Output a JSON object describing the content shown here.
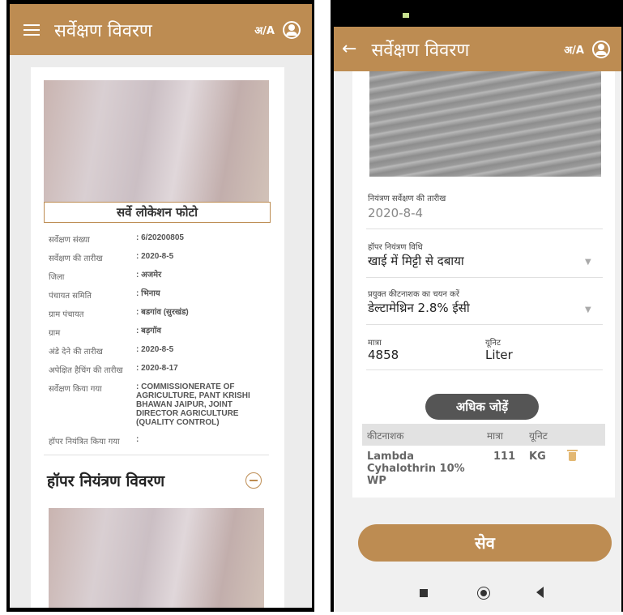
{
  "left": {
    "header": {
      "title": "सर्वेक्षण विवरण",
      "lang": "अ/A"
    },
    "photo_caption": "सर्वे लोकेशन फोटो",
    "info": [
      {
        "label": "सर्वेक्षण संख्या",
        "value": ": 6/20200805"
      },
      {
        "label": "सर्वेक्षण की तारीख",
        "value": ": 2020-8-5"
      },
      {
        "label": "जिला",
        "value": ": अजमेर"
      },
      {
        "label": "पंचायत समिति",
        "value": ": भिनाय"
      },
      {
        "label": "ग्राम पंचायत",
        "value": ": बडगांव (सुरखंड)"
      },
      {
        "label": "ग्राम",
        "value": ": बड़गॉव"
      },
      {
        "label": "अंडे देने की तारीख",
        "value": ": 2020-8-5"
      },
      {
        "label": "अपेक्षित हैचिंग की तारीख",
        "value": ": 2020-8-17"
      },
      {
        "label": "सर्वेक्षण किया गया",
        "value": ": COMMISSIONERATE OF AGRICULTURE, PANT KRISHI BHAWAN JAIPUR, JOINT DIRECTOR AGRICULTURE (QUALITY CONTROL)"
      },
      {
        "label": "हॉपर नियंत्रित किया गया",
        "value": ":"
      }
    ],
    "section_title": "हॉपर नियंत्रण विवरण"
  },
  "right": {
    "header": {
      "title": "सर्वेक्षण विवरण",
      "lang": "अ/A"
    },
    "control_date": {
      "label": "नियंत्रण सर्वेक्षण की तारीख",
      "value": "2020-8-4"
    },
    "method": {
      "label": "हॉपर नियंत्रण विधि",
      "value": "खाई में मिट्टी से दबाया"
    },
    "pesticide": {
      "label": "प्रयुक्त कीटनाशक का चयन करें",
      "value": "डेल्टामेथ्रिन 2.8% ईसी"
    },
    "quantity": {
      "label": "मात्रा",
      "value": "4858"
    },
    "unit": {
      "label": "यूनिट",
      "value": "Liter"
    },
    "add_more": "अधिक जोड़ें",
    "table": {
      "headers": [
        "कीटनाशक",
        "मात्रा",
        "यूनिट"
      ],
      "rows": [
        {
          "pesticide": "Lambda Cyhalothrin 10% WP",
          "qty": "111",
          "unit": "KG"
        }
      ]
    },
    "save": "सेव"
  }
}
